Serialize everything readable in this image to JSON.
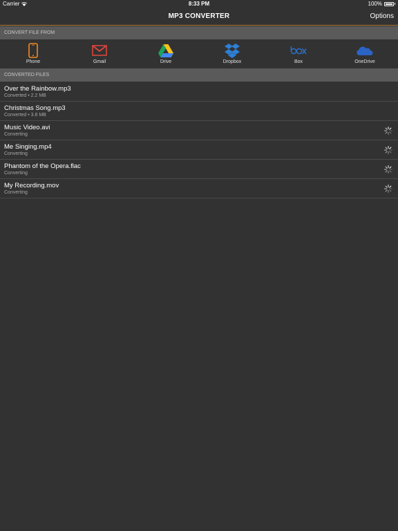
{
  "status_bar": {
    "carrier": "Carrier",
    "time": "8:33 PM",
    "battery": "100%"
  },
  "nav": {
    "title": "MP3 CONVERTER",
    "options_label": "Options"
  },
  "convert_section": {
    "header": "CONVERT FILE FROM",
    "sources": [
      {
        "label": "Phone",
        "icon": "phone-icon"
      },
      {
        "label": "Gmail",
        "icon": "gmail-icon"
      },
      {
        "label": "Drive",
        "icon": "google-drive-icon"
      },
      {
        "label": "Dropbox",
        "icon": "dropbox-icon"
      },
      {
        "label": "Box",
        "icon": "box-icon"
      },
      {
        "label": "OneDrive",
        "icon": "onedrive-icon"
      }
    ]
  },
  "converted_section": {
    "header": "CONVERTED FILES",
    "files": [
      {
        "name": "Over the Rainbow.mp3",
        "status": "Converted • 2.2 MB"
      },
      {
        "name": "Christmas Song.mp3",
        "status": "Converted • 3.8 MB"
      },
      {
        "name": "Music Video.avi",
        "status": "Converting"
      },
      {
        "name": "Me Singing.mp4",
        "status": "Converting"
      },
      {
        "name": "Phantom of the Opera.flac",
        "status": "Converting"
      },
      {
        "name": "My Recording.mov",
        "status": "Converting"
      }
    ]
  },
  "colors": {
    "background": "#323232",
    "header_bar": "#5a5a5a",
    "accent_line": "#b07a2c",
    "phone": "#f28a1e",
    "gmail": "#d9453c",
    "dropbox": "#2e7fd6",
    "box": "#2d6fc2",
    "onedrive": "#2b64c4"
  }
}
